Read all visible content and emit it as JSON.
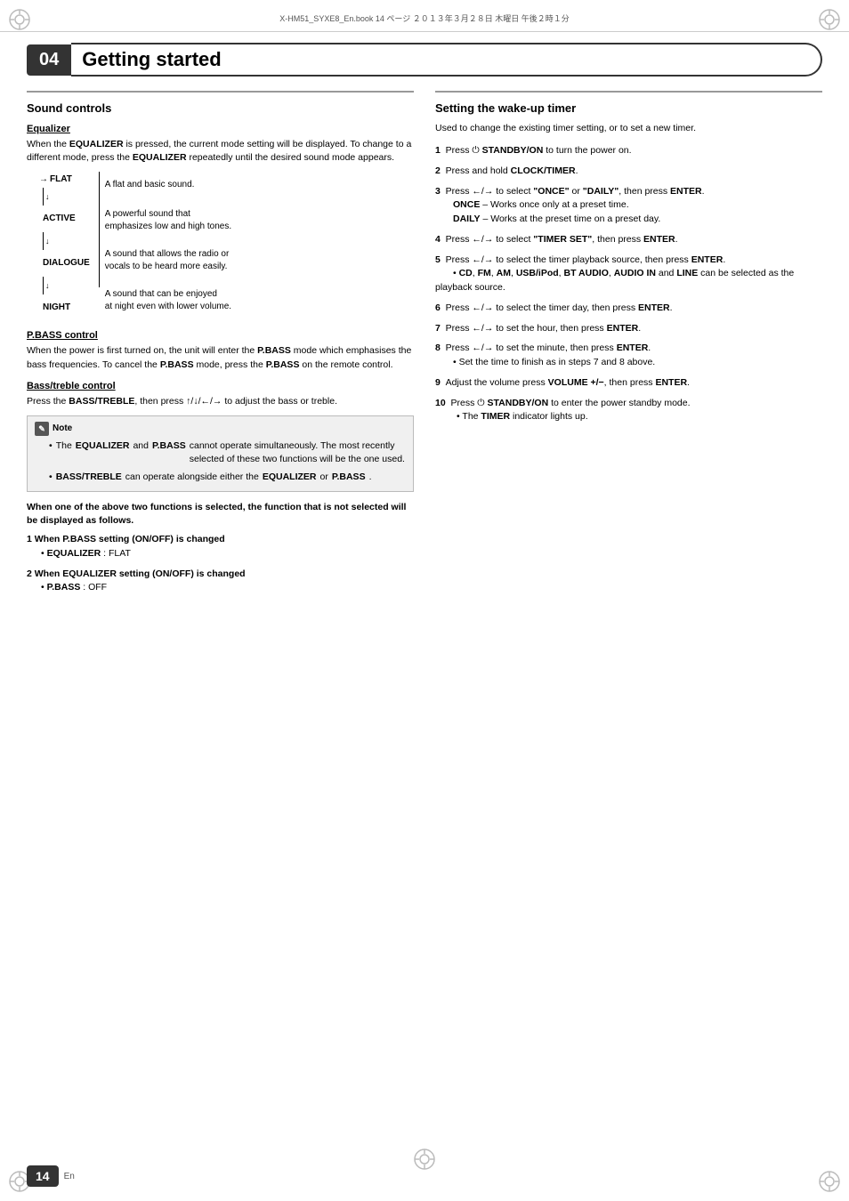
{
  "header": {
    "meta_text": "X-HM51_SYXE8_En.book   14 ページ   ２０１３年３月２８日   木曜日   午後２時１分"
  },
  "chapter": {
    "number": "04",
    "title": "Getting started"
  },
  "left_col": {
    "section_title": "Sound controls",
    "equalizer": {
      "title": "Equalizer",
      "intro": "When the EQUALIZER is pressed, the current mode setting will be displayed. To change to a different mode, press the EQUALIZER repeatedly until the desired sound mode appears.",
      "modes": [
        {
          "label": "FLAT",
          "desc": "A flat and basic sound."
        },
        {
          "label": "ACTIVE",
          "desc": "A powerful sound that emphasizes low and high tones."
        },
        {
          "label": "DIALOGUE",
          "desc": "A sound that allows the radio or vocals to be heard more easily."
        },
        {
          "label": "NIGHT",
          "desc": "A sound that can be enjoyed at night even with lower volume."
        }
      ]
    },
    "pbass": {
      "title": "P.BASS control",
      "text": "When the power is first turned on, the unit will enter the P.BASS mode which emphasises the bass frequencies. To cancel the P.BASS mode, press the P.BASS on the remote control."
    },
    "bass_treble": {
      "title": "Bass/treble control",
      "text": "Press the BASS/TREBLE, then press ↑/↓/←/→ to adjust the bass or treble."
    },
    "note": {
      "title": "Note",
      "bullets": [
        "The EQUALIZER and P.BASS cannot operate simultaneously. The most recently selected of these two functions will be the one used.",
        "BASS/TREBLE can operate alongside either the EQUALIZER or P.BASS."
      ]
    },
    "bold_heading": "When one of the above two functions is selected, the function that is not selected will be displayed as follows.",
    "steps": [
      {
        "num": "1",
        "label": "When P.BASS setting (ON/OFF) is changed",
        "bullets": [
          "EQUALIZER : FLAT"
        ]
      },
      {
        "num": "2",
        "label": "When EQUALIZER setting (ON/OFF) is changed",
        "bullets": [
          "P.BASS : OFF"
        ]
      }
    ]
  },
  "right_col": {
    "section_title": "Setting the wake-up timer",
    "intro": "Used to change the existing timer setting, or to set a new timer.",
    "steps": [
      {
        "num": "1",
        "text": "Press ⏻ STANDBY/ON to turn the power on."
      },
      {
        "num": "2",
        "text": "Press and hold CLOCK/TIMER."
      },
      {
        "num": "3",
        "text": "Press ←/→ to select \"ONCE\" or \"DAILY\", then press ENTER.",
        "sub_bullets": [
          "ONCE – Works once only at a preset time.",
          "DAILY – Works at the preset time on a preset day."
        ]
      },
      {
        "num": "4",
        "text": "Press ←/→ to select \"TIMER SET\", then press ENTER."
      },
      {
        "num": "5",
        "text": "Press ←/→ to select the timer playback source, then press ENTER.",
        "sub_bullets": [
          "CD, FM, AM, USB/iPod, BT AUDIO, AUDIO IN and LINE can be selected as the playback source."
        ]
      },
      {
        "num": "6",
        "text": "Press ←/→ to select the timer day, then press ENTER."
      },
      {
        "num": "7",
        "text": "Press ←/→ to set the hour, then press ENTER."
      },
      {
        "num": "8",
        "text": "Press ←/→ to set the minute, then press ENTER.",
        "sub_bullets": [
          "Set the time to finish as in steps 7 and 8 above."
        ]
      },
      {
        "num": "9",
        "text": "Adjust the volume press VOLUME +/−, then press ENTER."
      },
      {
        "num": "10",
        "text": "Press ⏻ STANDBY/ON to enter the power standby mode.",
        "sub_bullets": [
          "The TIMER indicator lights up."
        ]
      }
    ]
  },
  "footer": {
    "page_num": "14",
    "lang": "En"
  }
}
